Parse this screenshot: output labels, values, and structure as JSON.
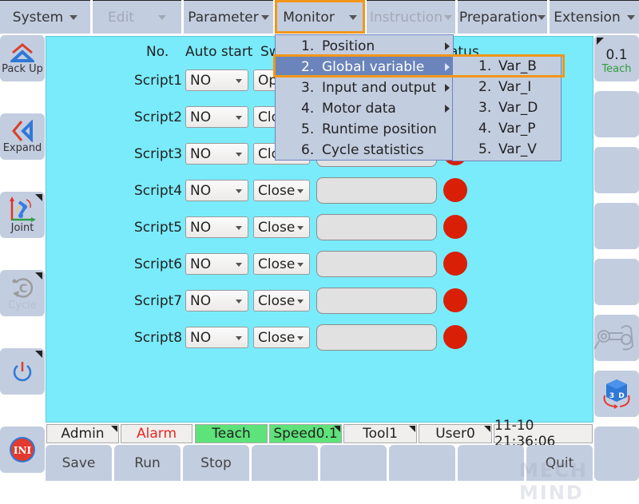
{
  "top_menu": [
    {
      "label": "System",
      "enabled": true
    },
    {
      "label": "Edit",
      "enabled": false
    },
    {
      "label": "Parameter",
      "enabled": true
    },
    {
      "label": "Monitor",
      "enabled": true,
      "active": true
    },
    {
      "label": "Instruction",
      "enabled": false
    },
    {
      "label": "Preparation",
      "enabled": true
    },
    {
      "label": "Extension",
      "enabled": true
    }
  ],
  "left_sidebar": [
    {
      "label": "Pack Up",
      "icon": "pack-up-icon"
    },
    {
      "label": "Expand",
      "icon": "expand-icon"
    },
    {
      "label": "Joint",
      "icon": "joint-coordinate-icon"
    },
    {
      "label": "Cycle",
      "icon": "cycle-icon",
      "enabled": false
    },
    {
      "label": "",
      "icon": "power-icon"
    },
    {
      "label": "",
      "icon": "ini-icon",
      "icon_text": "INI"
    }
  ],
  "right_sidebar": {
    "speed_button": {
      "value": "0.1",
      "mode": "Teach"
    },
    "buttons": [
      {
        "icon": "robot-hand-guide-icon",
        "enabled": false
      },
      {
        "icon": "3d-view-icon",
        "icon_text": "3D"
      }
    ]
  },
  "table": {
    "headers": {
      "no": "No.",
      "auto_start": "Auto start",
      "switch": "Sw",
      "status": "Status"
    },
    "status_partial": "atus",
    "rows": [
      {
        "name": "Script1",
        "auto_start": "NO",
        "switch": "Open",
        "switch_visible": "Op",
        "state": "stopped"
      },
      {
        "name": "Script2",
        "auto_start": "NO",
        "switch": "Close",
        "switch_visible": "Clo",
        "state": "stopped"
      },
      {
        "name": "Script3",
        "auto_start": "NO",
        "switch": "Close",
        "switch_visible": "Clo",
        "state": "stopped"
      },
      {
        "name": "Script4",
        "auto_start": "NO",
        "switch": "Close",
        "state": "stopped"
      },
      {
        "name": "Script5",
        "auto_start": "NO",
        "switch": "Close",
        "state": "stopped"
      },
      {
        "name": "Script6",
        "auto_start": "NO",
        "switch": "Close",
        "state": "stopped"
      },
      {
        "name": "Script7",
        "auto_start": "NO",
        "switch": "Close",
        "state": "stopped"
      },
      {
        "name": "Script8",
        "auto_start": "NO",
        "switch": "Close",
        "state": "stopped"
      }
    ],
    "led_color": "#d91f05"
  },
  "monitor_menu": {
    "items": [
      {
        "num": "1.",
        "label": "Position",
        "has_submenu": true
      },
      {
        "num": "2.",
        "label": "Global variable",
        "has_submenu": true,
        "highlighted": true
      },
      {
        "num": "3.",
        "label": "Input and output",
        "has_submenu": true
      },
      {
        "num": "4.",
        "label": "Motor data",
        "has_submenu": true
      },
      {
        "num": "5.",
        "label": "Runtime position",
        "has_submenu": false
      },
      {
        "num": "6.",
        "label": "Cycle statistics",
        "has_submenu": false
      }
    ],
    "submenu": [
      {
        "num": "1.",
        "label": "Var_B",
        "highlighted": true
      },
      {
        "num": "2.",
        "label": "Var_I"
      },
      {
        "num": "3.",
        "label": "Var_D"
      },
      {
        "num": "4.",
        "label": "Var_P"
      },
      {
        "num": "5.",
        "label": "Var_V"
      }
    ]
  },
  "status_bar": {
    "user": "Admin",
    "alarm": "Alarm",
    "mode": "Teach",
    "speed": "Speed0.1",
    "tool": "Tool1",
    "user_frame": "User0",
    "datetime": "11-10 21:36:06"
  },
  "bottom_buttons": [
    "Save",
    "Run",
    "Stop",
    "",
    "",
    "",
    "",
    "",
    "Quit"
  ],
  "watermark": "MECH MIND",
  "colors": {
    "panel_bg": "#7aebfa",
    "menu_bg": "#c3cde0",
    "highlight": "#6b84bb",
    "focus_outline": "#f2961a",
    "status_green": "#5ee27a",
    "alarm_text": "#e8281e",
    "teach_text": "#2f9e3a"
  }
}
